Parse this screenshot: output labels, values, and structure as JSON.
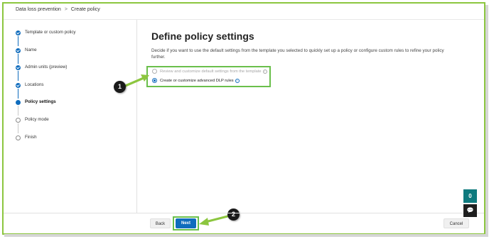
{
  "breadcrumb": {
    "root": "Data loss prevention",
    "separator": ">",
    "current": "Create policy"
  },
  "steps": [
    {
      "label": "Template or custom policy",
      "state": "done"
    },
    {
      "label": "Name",
      "state": "done"
    },
    {
      "label": "Admin units (preview)",
      "state": "done"
    },
    {
      "label": "Locations",
      "state": "done"
    },
    {
      "label": "Policy settings",
      "state": "current"
    },
    {
      "label": "Policy mode",
      "state": "todo"
    },
    {
      "label": "Finish",
      "state": "todo"
    }
  ],
  "main": {
    "title": "Define policy settings",
    "description": "Decide if you want to use the default settings from the template you selected to quickly set up a policy or configure custom rules to refine your policy further.",
    "options": [
      {
        "label": "Review and customize default settings from the template",
        "selected": false,
        "disabled": true
      },
      {
        "label": "Create or customize advanced DLP rules",
        "selected": true,
        "disabled": false
      }
    ]
  },
  "footer": {
    "back_label": "Back",
    "next_label": "Next",
    "cancel_label": "Cancel"
  },
  "callouts": {
    "one": "1",
    "two": "2"
  },
  "side_buttons": {
    "a": "0",
    "b": "💬"
  },
  "icons": {
    "info": "info-icon",
    "check": "check-icon"
  },
  "colors": {
    "accent": "#0f6cbd",
    "highlight": "#6abf4b",
    "frame": "#8cc63f"
  }
}
